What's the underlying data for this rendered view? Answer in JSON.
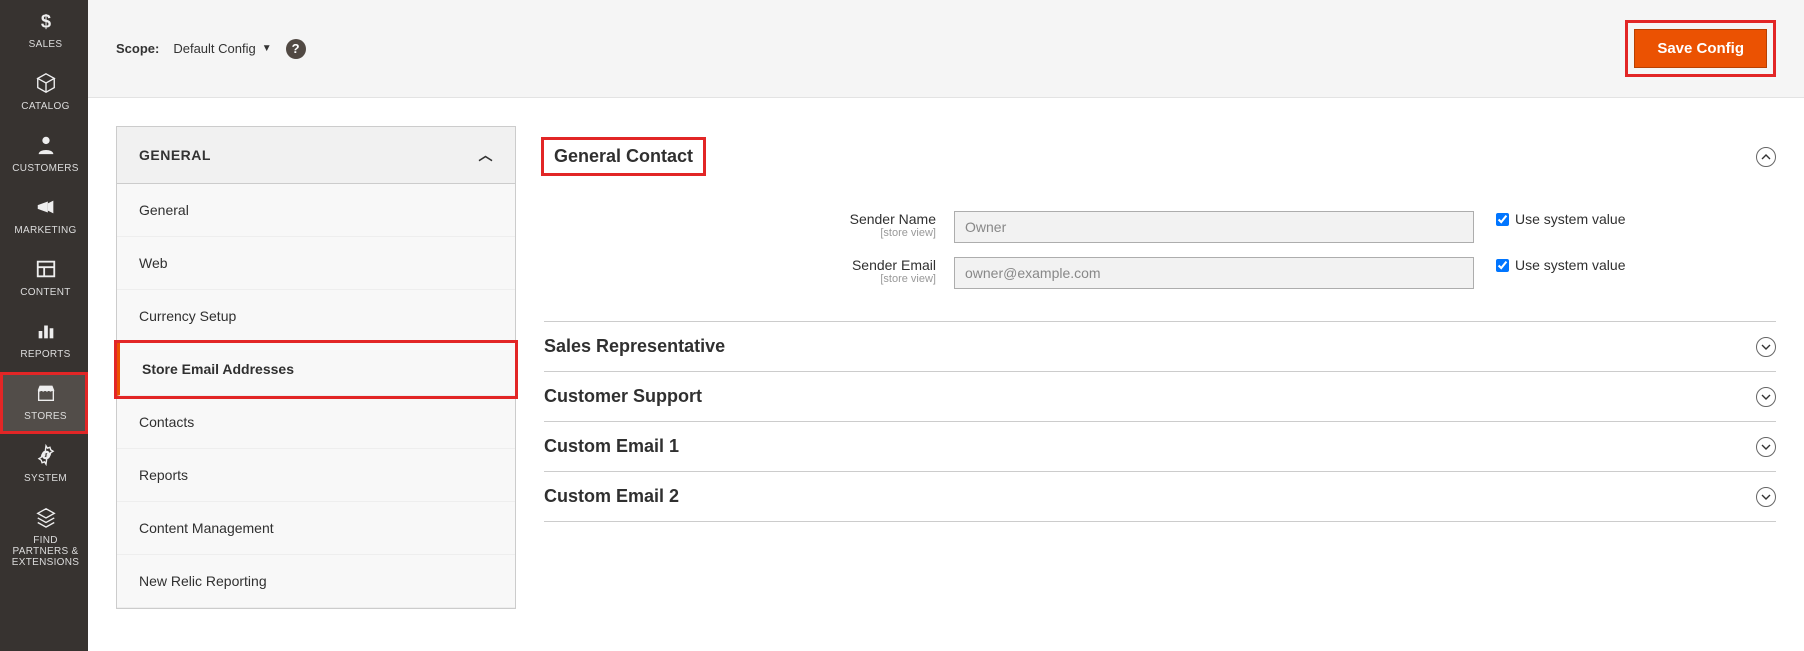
{
  "nav": {
    "items": [
      {
        "label": "SALES",
        "icon": "dollar"
      },
      {
        "label": "CATALOG",
        "icon": "cube"
      },
      {
        "label": "CUSTOMERS",
        "icon": "person"
      },
      {
        "label": "MARKETING",
        "icon": "megaphone"
      },
      {
        "label": "CONTENT",
        "icon": "layout"
      },
      {
        "label": "REPORTS",
        "icon": "bars"
      },
      {
        "label": "STORES",
        "icon": "storefront"
      },
      {
        "label": "SYSTEM",
        "icon": "gear"
      },
      {
        "label": "FIND PARTNERS & EXTENSIONS",
        "icon": "stack"
      }
    ],
    "active_index": 6
  },
  "topbar": {
    "scope_label": "Scope:",
    "scope_value": "Default Config",
    "save_label": "Save Config"
  },
  "config_tabs": {
    "group_label": "GENERAL",
    "items": [
      "General",
      "Web",
      "Currency Setup",
      "Store Email Addresses",
      "Contacts",
      "Reports",
      "Content Management",
      "New Relic Reporting"
    ],
    "active_index": 3
  },
  "sections": {
    "general_contact": {
      "title": "General Contact",
      "fields": [
        {
          "label": "Sender Name",
          "scope": "[store view]",
          "value": "Owner",
          "use_system": true,
          "use_system_label": "Use system value"
        },
        {
          "label": "Sender Email",
          "scope": "[store view]",
          "value": "owner@example.com",
          "use_system": true,
          "use_system_label": "Use system value"
        }
      ]
    },
    "collapsed": [
      "Sales Representative",
      "Customer Support",
      "Custom Email 1",
      "Custom Email 2"
    ]
  }
}
